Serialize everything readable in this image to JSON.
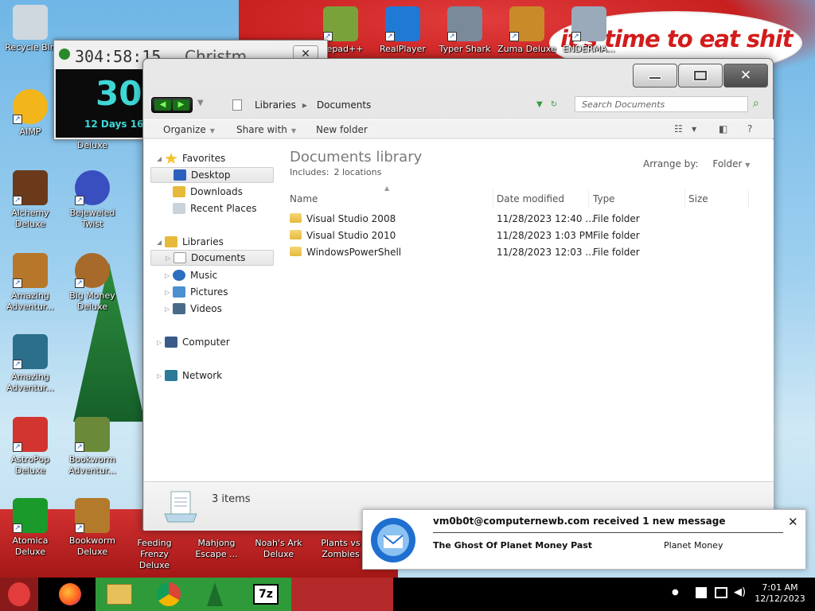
{
  "desktop": {
    "bubble_text": "it's time to eat shit",
    "icons": [
      {
        "label": "Recycle Bin",
        "color": "#cfd7df"
      },
      {
        "label": "AIMP",
        "color": "#f2b61b"
      },
      {
        "label": "Alchemy Deluxe",
        "color": "#6a3a1a"
      },
      {
        "label": "Amazing Adventur...",
        "color": "#b6772a"
      },
      {
        "label": "Amazing Adventur...",
        "color": "#2c6f8c"
      },
      {
        "label": "AstroPop Deluxe",
        "color": "#d2342f"
      },
      {
        "label": "Atomica Deluxe",
        "color": "#1a9a2a"
      },
      {
        "label": "Deluxe",
        "color": "#333333"
      },
      {
        "label": "Bejeweled Twist",
        "color": "#3a4fbf"
      },
      {
        "label": "Big Money Deluxe",
        "color": "#a76a2a"
      },
      {
        "label": "Bookworm Adventur...",
        "color": "#6a8a3a"
      },
      {
        "label": "Bookworm Deluxe",
        "color": "#b27a2a"
      },
      {
        "label": "Feeding Frenzy Deluxe",
        "color": "#2d6fbf"
      },
      {
        "label": "Mahjong Escape ...",
        "color": "#8a5a2a"
      },
      {
        "label": "Noah's Ark Deluxe",
        "color": "#6a3a1a"
      },
      {
        "label": "Plants vs Zombies",
        "color": "#3a8a2a"
      },
      {
        "label": "otepad++",
        "color": "#7aa23a"
      },
      {
        "label": "RealPlayer",
        "color": "#1f7ad6"
      },
      {
        "label": "Typer Shark",
        "color": "#7a8a9a"
      },
      {
        "label": "Zuma Deluxe",
        "color": "#c98a2a"
      },
      {
        "label": "ENDERMA...",
        "color": "#9aaabb"
      }
    ]
  },
  "countdown": {
    "time": "304:58:15",
    "title": "Christm",
    "close": "✕",
    "big_number": "30",
    "days_label": "12 Days 16"
  },
  "explorer": {
    "caption": {
      "minimize": "—",
      "maximize": "☐",
      "close": "✕"
    },
    "address": {
      "crumbs": [
        "Libraries",
        "Documents"
      ],
      "separator": "▸"
    },
    "search_placeholder": "Search Documents",
    "toolbar": {
      "organize": "Organize",
      "share_with": "Share with",
      "new_folder": "New folder",
      "help": "?"
    },
    "nav": {
      "favorites": "Favorites",
      "desktop": "Desktop",
      "downloads": "Downloads",
      "recent_places": "Recent Places",
      "libraries": "Libraries",
      "documents": "Documents",
      "music": "Music",
      "pictures": "Pictures",
      "videos": "Videos",
      "computer": "Computer",
      "network": "Network"
    },
    "library": {
      "title": "Documents library",
      "includes_label": "Includes:",
      "includes_value": "2 locations",
      "arrange_label": "Arrange by:",
      "arrange_value": "Folder"
    },
    "columns": {
      "name": "Name",
      "date": "Date modified",
      "type": "Type",
      "size": "Size"
    },
    "files": [
      {
        "name": "Visual Studio 2008",
        "date": "11/28/2023 12:40 ...",
        "type": "File folder"
      },
      {
        "name": "Visual Studio 2010",
        "date": "11/28/2023 1:03 PM",
        "type": "File folder"
      },
      {
        "name": "WindowsPowerShell",
        "date": "11/28/2023 12:03 ...",
        "type": "File folder"
      }
    ],
    "status": "3 items"
  },
  "notification": {
    "header": "vm0b0t@computernewb.com received 1 new message",
    "subject": "The Ghost Of Planet Money Past",
    "sender": "Planet Money",
    "close": "✕"
  },
  "taskbar": {
    "time": "7:01 AM",
    "date": "12/12/2023",
    "tray_dot": "●"
  }
}
